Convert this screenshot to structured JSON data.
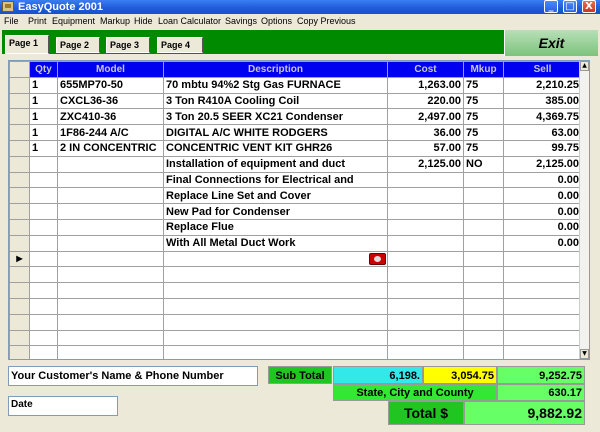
{
  "window": {
    "title": "EasyQuote  2001",
    "minimize": "_",
    "maximize": "□",
    "close": "X"
  },
  "menu": [
    "File",
    "Print",
    "Equipment",
    "Markup",
    "Hide",
    "Loan Calculator",
    "Savings",
    "Options",
    "Copy Previous"
  ],
  "tabs": [
    "Page 1",
    "Page 2",
    "Page 3",
    "Page 4"
  ],
  "active_tab": "Page 1",
  "exit_label": "Exit",
  "grid": {
    "columns": [
      "Qty",
      "Model",
      "Description",
      "Cost",
      "Mkup",
      "Sell"
    ],
    "rows": [
      {
        "qty": "1",
        "model": "655MP70-50",
        "description": "70 mbtu 94%2 Stg Gas FURNACE",
        "cost": "1,263.00",
        "mkup": "75",
        "sell": "2,210.25"
      },
      {
        "qty": "1",
        "model": "CXCL36-36",
        "description": "3 Ton R410A Cooling Coil",
        "cost": "220.00",
        "mkup": "75",
        "sell": "385.00"
      },
      {
        "qty": "1",
        "model": "ZXC410-36",
        "description": "3 Ton 20.5 SEER XC21 Condenser",
        "cost": "2,497.00",
        "mkup": "75",
        "sell": "4,369.75"
      },
      {
        "qty": "1",
        "model": "1F86-244  A/C",
        "description": "DIGITAL A/C WHITE RODGERS",
        "cost": "36.00",
        "mkup": "75",
        "sell": "63.00"
      },
      {
        "qty": "1",
        "model": "2 IN CONCENTRIC",
        "description": "CONCENTRIC VENT KIT GHR26",
        "cost": "57.00",
        "mkup": "75",
        "sell": "99.75"
      },
      {
        "qty": "",
        "model": "",
        "description": "Installation of equipment and duct",
        "cost": "2,125.00",
        "mkup": "NO",
        "sell": "2,125.00"
      },
      {
        "qty": "",
        "model": "",
        "description": "Final Connections for Electrical and",
        "cost": "",
        "mkup": "",
        "sell": "0.00"
      },
      {
        "qty": "",
        "model": "",
        "description": "Replace Line Set and Cover",
        "cost": "",
        "mkup": "",
        "sell": "0.00"
      },
      {
        "qty": "",
        "model": "",
        "description": "New Pad for Condenser",
        "cost": "",
        "mkup": "",
        "sell": "0.00"
      },
      {
        "qty": "",
        "model": "",
        "description": "Replace Flue",
        "cost": "",
        "mkup": "",
        "sell": "0.00"
      },
      {
        "qty": "",
        "model": "",
        "description": "With All Metal Duct Work",
        "cost": "",
        "mkup": "",
        "sell": "0.00"
      }
    ],
    "current_row_marker": "▶",
    "blank_rows": 7
  },
  "customer_placeholder": "Your Customer's Name & Phone Number",
  "date_label": "Date",
  "totals": {
    "subtotal_label": "Sub Total",
    "cost_total": "6,198.",
    "markup_total": "3,054.75",
    "sell_total": "9,252.75",
    "tax_label": "State, City and County",
    "tax_value": "630.17",
    "total_label": "Total $",
    "total_value": "9,882.92"
  },
  "colors": {
    "header_blue": "#0000f0",
    "tab_green": "#008a00",
    "subtotal_cyan": "#33e8e8",
    "markup_yellow": "#ffff00",
    "sell_green": "#66ff66"
  }
}
